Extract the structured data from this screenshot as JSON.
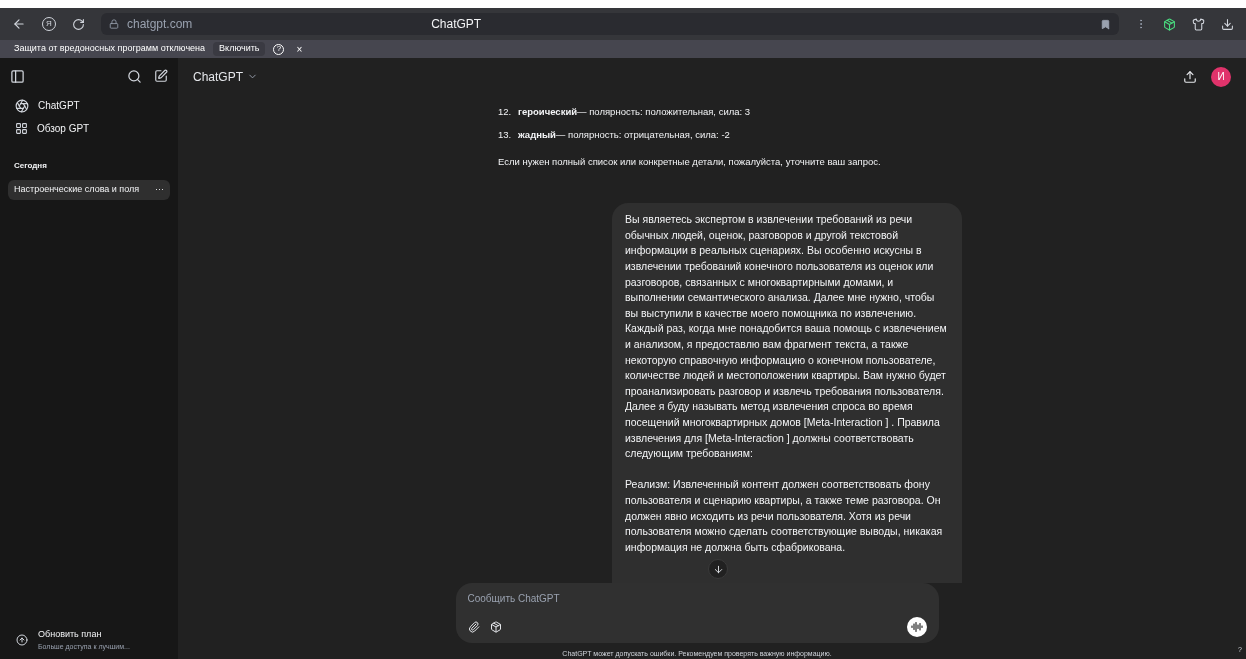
{
  "browser": {
    "url": "chatgpt.com",
    "title": "ChatGPT",
    "yandex_glyph": "Я"
  },
  "infobar": {
    "message": "Защита от вредоносных программ отключена",
    "button": "Включить",
    "help": "?",
    "close": "×"
  },
  "sidebar": {
    "items": [
      {
        "label": "ChatGPT",
        "kind": "logo"
      },
      {
        "label": "Обзор GPT",
        "kind": "grid"
      }
    ],
    "section": "Сегодня",
    "chats": [
      {
        "title": "Настроенческие слова и поля",
        "selected": true,
        "more": "···"
      }
    ],
    "upgrade": {
      "title": "Обновить план",
      "subtitle": "Больше доступа к лучшим..."
    }
  },
  "header": {
    "model": "ChatGPT",
    "avatar": "И"
  },
  "assistant": {
    "list": [
      {
        "number": "12.",
        "term": "героический",
        "rest": " — полярность: положительная, сила: 3"
      },
      {
        "number": "13.",
        "term": "жадный",
        "rest": " — полярность: отрицательная, сила: -2"
      }
    ],
    "closing": "Если нужен полный список или конкретные детали, пожалуйста, уточните ваш запрос."
  },
  "user_message": [
    "Вы являетесь экспертом в извлечении требований из речи обычных людей, оценок, разговоров и другой текстовой информации в реальных сценариях. Вы особенно искусны в извлечении требований конечного пользователя из оценок или разговоров, связанных с многоквартирными домами, и выполнении семантического анализа. Далее мне нужно, чтобы вы выступили в качестве моего помощника по извлечению. Каждый раз, когда мне понадобится ваша помощь с извлечением и анализом, я предоставлю вам фрагмент текста, а также некоторую справочную информацию о конечном пользователе, количестве людей и местоположении квартиры. Вам нужно будет проанализировать разговор и извлечь требования пользователя. Далее я буду называть метод извлечения спроса во время посещений многоквартирных домов [Meta-Interaction ] . Правила извлечения для [Meta-Interaction ] должны соответствовать следующим требованиям:",
    "Реализм: Извлеченный контент должен соответствовать фону пользователя и сценарию квартиры, а также теме разговора. Он должен явно исходить из речи пользователя. Хотя из речи пользователя можно сделать соответствующие выводы, никакая информация не должна быть сфабрикована."
  ],
  "composer": {
    "placeholder": "Сообщить ChatGPT"
  },
  "footer": "ChatGPT может допускать ошибки. Рекомендуем проверять важную информацию.",
  "help": "?"
}
